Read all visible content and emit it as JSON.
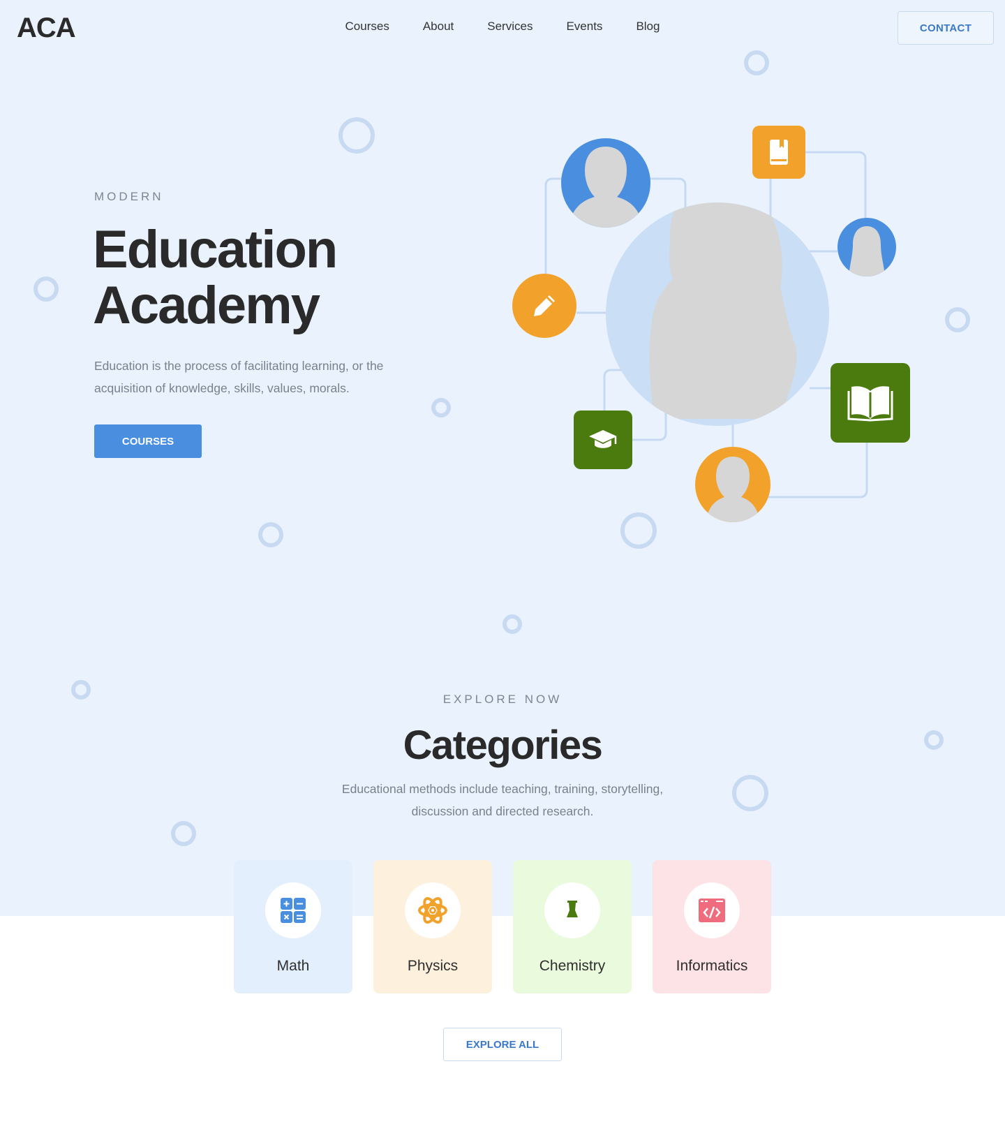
{
  "brand": {
    "logo_text": "ACA"
  },
  "nav": {
    "items": [
      "Courses",
      "About",
      "Services",
      "Events",
      "Blog"
    ],
    "contact_label": "CONTACT"
  },
  "hero": {
    "eyebrow": "MODERN",
    "title_line1": "Education",
    "title_line2": "Academy",
    "description": "Education is the process of facilitating learning, or the acquisition of knowledge, skills, values, morals.",
    "cta_label": "COURSES"
  },
  "categories": {
    "eyebrow": "EXPLORE NOW",
    "title": "Categories",
    "description": "Educational methods include teaching, training, storytelling, discussion and directed research.",
    "items": [
      {
        "label": "Math",
        "icon": "calculator-icon",
        "bg": "#e4effd",
        "accent": "#4a8ee0"
      },
      {
        "label": "Physics",
        "icon": "atom-icon",
        "bg": "#fdf1de",
        "accent": "#f2a22a"
      },
      {
        "label": "Chemistry",
        "icon": "flask-icon",
        "bg": "#e9fbdc",
        "accent": "#4b7a0e"
      },
      {
        "label": "Informatics",
        "icon": "code-icon",
        "bg": "#fde2e6",
        "accent": "#ee6c7d"
      }
    ],
    "explore_label": "EXPLORE ALL"
  },
  "colors": {
    "primary": "#4a8ee0",
    "orange": "#f2a22a",
    "green": "#4b7a0e",
    "hero_bg": "#eaf3fd",
    "text_dark": "#2a2a2a"
  }
}
